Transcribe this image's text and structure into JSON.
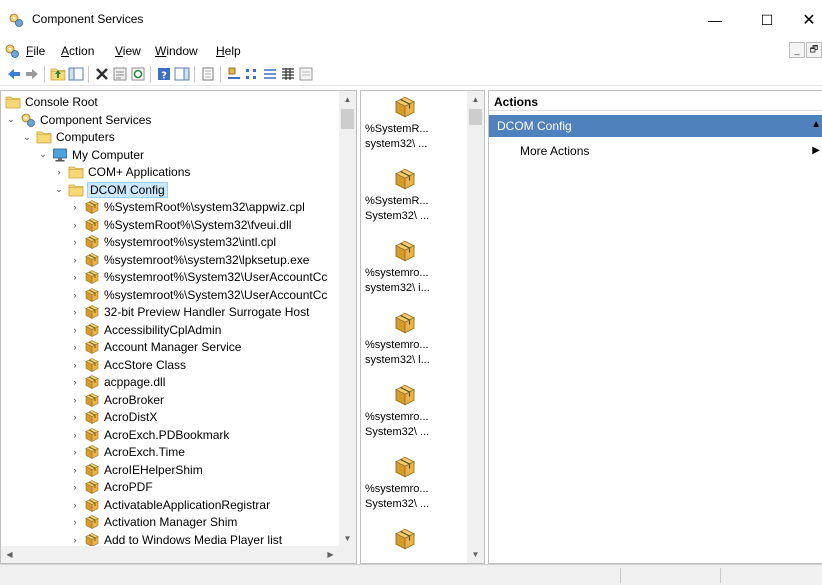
{
  "window": {
    "title": "Component Services",
    "controls": {
      "minimize": "—",
      "maximize": "☐",
      "close": "✕"
    }
  },
  "menubar": {
    "items": [
      {
        "label": "File",
        "mnemonic": "F",
        "rest": "ile"
      },
      {
        "label": "Action",
        "mnemonic": "A",
        "rest": "ction"
      },
      {
        "label": "View",
        "mnemonic": "V",
        "rest": "iew"
      },
      {
        "label": "Window",
        "mnemonic": "W",
        "rest": "indow"
      },
      {
        "label": "Help",
        "mnemonic": "H",
        "rest": "elp"
      }
    ],
    "mdi": {
      "minimize": "_",
      "restore": "🗗"
    }
  },
  "toolbar": {
    "buttons": [
      "back-icon",
      "forward-icon",
      "up-folder-icon",
      "show-hide-tree-icon",
      "delete-icon",
      "properties-icon",
      "refresh-icon",
      "help-icon",
      "show-hide-action-pane-icon",
      "export-list-icon",
      "large-icons-view-icon",
      "small-icons-view-icon",
      "list-view-icon",
      "detail-view-icon",
      "status-view-icon"
    ]
  },
  "tree": {
    "nodes": [
      {
        "label": "Console Root",
        "chev": "",
        "icon": "folder-icon"
      },
      {
        "label": "Component Services",
        "chev": "⌄",
        "icon": "component-services-icon"
      },
      {
        "label": "Computers",
        "chev": "⌄",
        "icon": "folder-icon"
      },
      {
        "label": "My Computer",
        "chev": "⌄",
        "icon": "computer-icon"
      },
      {
        "label": "COM+ Applications",
        "chev": "›",
        "icon": "folder-icon"
      },
      {
        "label": "DCOM Config",
        "chev": "⌄",
        "icon": "folder-icon",
        "selected": true
      },
      {
        "label": "%SystemRoot%\\system32\\appwiz.cpl",
        "chev": "›",
        "icon": "com-package-icon"
      },
      {
        "label": "%SystemRoot%\\System32\\fveui.dll",
        "chev": "›",
        "icon": "com-package-icon"
      },
      {
        "label": "%systemroot%\\system32\\intl.cpl",
        "chev": "›",
        "icon": "com-package-icon"
      },
      {
        "label": "%systemroot%\\system32\\lpksetup.exe",
        "chev": "›",
        "icon": "com-package-icon"
      },
      {
        "label": "%systemroot%\\System32\\UserAccountCc",
        "chev": "›",
        "icon": "com-package-icon"
      },
      {
        "label": "%systemroot%\\System32\\UserAccountCc",
        "chev": "›",
        "icon": "com-package-icon"
      },
      {
        "label": "32-bit Preview Handler Surrogate Host",
        "chev": "›",
        "icon": "com-package-icon"
      },
      {
        "label": "AccessibilityCplAdmin",
        "chev": "›",
        "icon": "com-package-icon"
      },
      {
        "label": "Account Manager Service",
        "chev": "›",
        "icon": "com-package-icon"
      },
      {
        "label": "AccStore Class",
        "chev": "›",
        "icon": "com-package-icon"
      },
      {
        "label": "acppage.dll",
        "chev": "›",
        "icon": "com-package-icon"
      },
      {
        "label": "AcroBroker",
        "chev": "›",
        "icon": "com-package-icon"
      },
      {
        "label": "AcroDistX",
        "chev": "›",
        "icon": "com-package-icon"
      },
      {
        "label": "AcroExch.PDBookmark",
        "chev": "›",
        "icon": "com-package-icon"
      },
      {
        "label": "AcroExch.Time",
        "chev": "›",
        "icon": "com-package-icon"
      },
      {
        "label": "AcroIEHelperShim",
        "chev": "›",
        "icon": "com-package-icon"
      },
      {
        "label": "AcroPDF",
        "chev": "›",
        "icon": "com-package-icon"
      },
      {
        "label": "ActivatableApplicationRegistrar",
        "chev": "›",
        "icon": "com-package-icon"
      },
      {
        "label": "Activation Manager Shim",
        "chev": "›",
        "icon": "com-package-icon"
      },
      {
        "label": "Add to Windows Media Player list",
        "chev": "›",
        "icon": "com-package-icon"
      }
    ]
  },
  "list": {
    "items": [
      {
        "line1": "%SystemR...",
        "line2": "system32\\ ..."
      },
      {
        "line1": "%SystemR...",
        "line2": "System32\\ ..."
      },
      {
        "line1": "%systemro...",
        "line2": "system32\\ i..."
      },
      {
        "line1": "%systemro...",
        "line2": "system32\\ l..."
      },
      {
        "line1": "%systemro...",
        "line2": "System32\\ ..."
      },
      {
        "line1": "%systemro...",
        "line2": "System32\\ ..."
      },
      {
        "line1": "",
        "line2": ""
      }
    ]
  },
  "actions": {
    "header": "Actions",
    "section": "DCOM Config",
    "section_collapse": "▲",
    "items": [
      {
        "label": "More Actions",
        "arrow": "▶"
      }
    ]
  },
  "colors": {
    "selection": "#cce8ff",
    "action_section": "#4f81bd",
    "package_gold": "#e8b24a"
  }
}
